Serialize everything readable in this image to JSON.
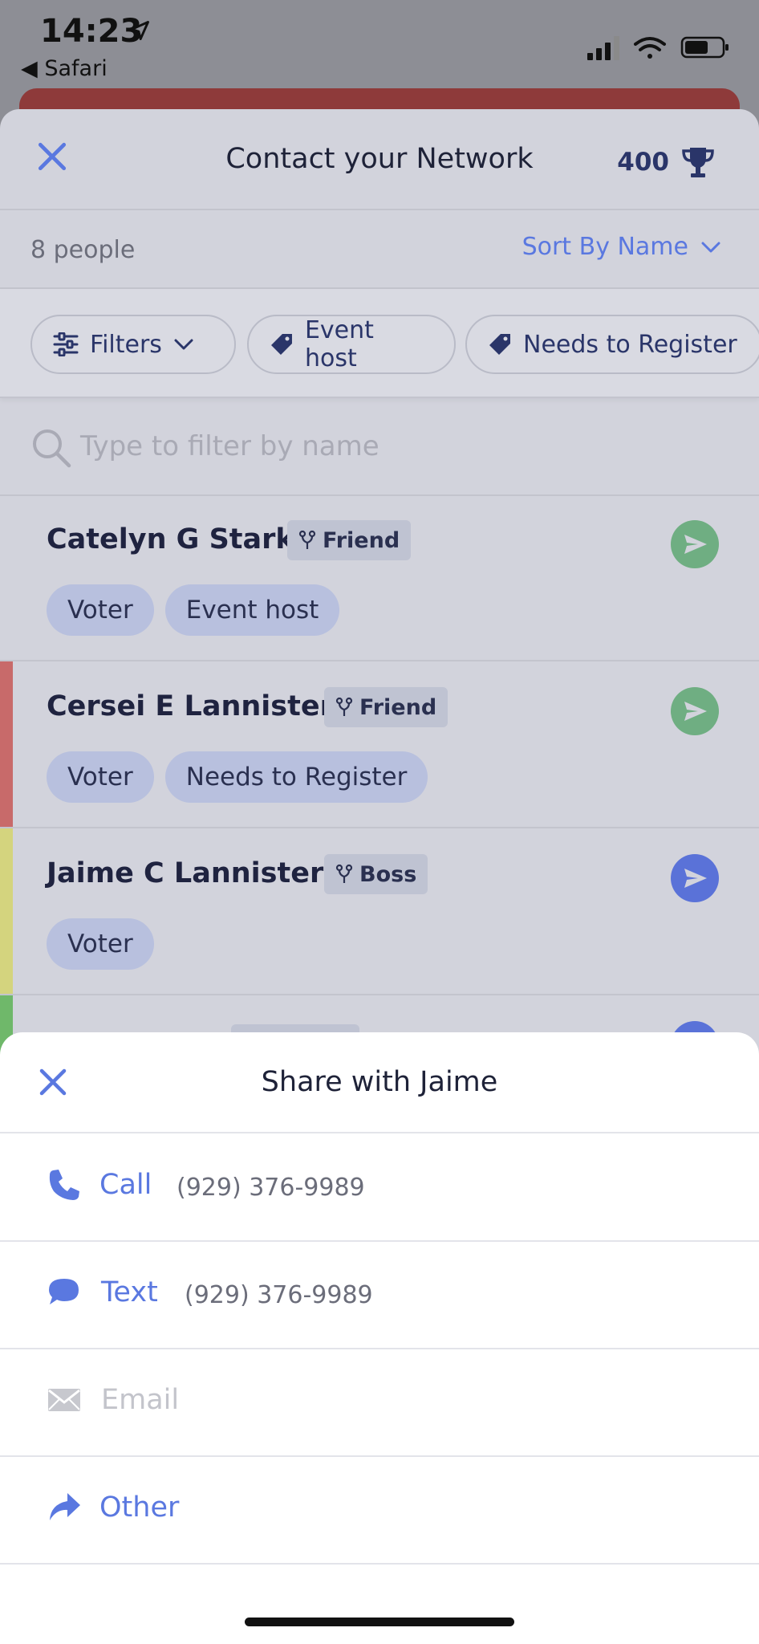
{
  "status_bar": {
    "time": "14:23",
    "back_app": "Safari"
  },
  "header": {
    "title": "Contact your Network",
    "score": "400"
  },
  "list_meta": {
    "count": "8 people",
    "sort_label": "Sort By Name"
  },
  "chips": {
    "filters": "Filters",
    "event_host": "Event host",
    "needs_register": "Needs to Register"
  },
  "search": {
    "placeholder": "Type to filter by name"
  },
  "contacts": [
    {
      "name": "Catelyn G Stark",
      "relation": "Friend",
      "tags": [
        "Voter",
        "Event host"
      ],
      "bar_color": "",
      "send_color": "#5fb57a"
    },
    {
      "name": "Cersei E Lannister",
      "relation": "Friend",
      "tags": [
        "Voter",
        "Needs to Register"
      ],
      "bar_color": "#c86a6a",
      "send_color": "#5fb57a"
    },
    {
      "name": "Jaime C Lannister",
      "relation": "Boss",
      "tags": [
        "Voter"
      ],
      "bar_color": "#d4d47e",
      "send_color": "#5a72d8"
    }
  ],
  "share": {
    "title": "Share with Jaime",
    "options": [
      {
        "label": "Call",
        "value": "(929) 376-9989",
        "icon": "phone-icon"
      },
      {
        "label": "Text",
        "value": "(929) 376-9989",
        "icon": "chat-bubble-icon"
      },
      {
        "label": "Email",
        "value": "",
        "icon": "envelope-icon",
        "disabled": true
      },
      {
        "label": "Other",
        "value": "",
        "icon": "share-arrow-icon"
      }
    ]
  },
  "colors": {
    "accent": "#5a78e0",
    "navy": "#2a3569",
    "green": "#5fb57a",
    "blue_send": "#5a72d8"
  }
}
